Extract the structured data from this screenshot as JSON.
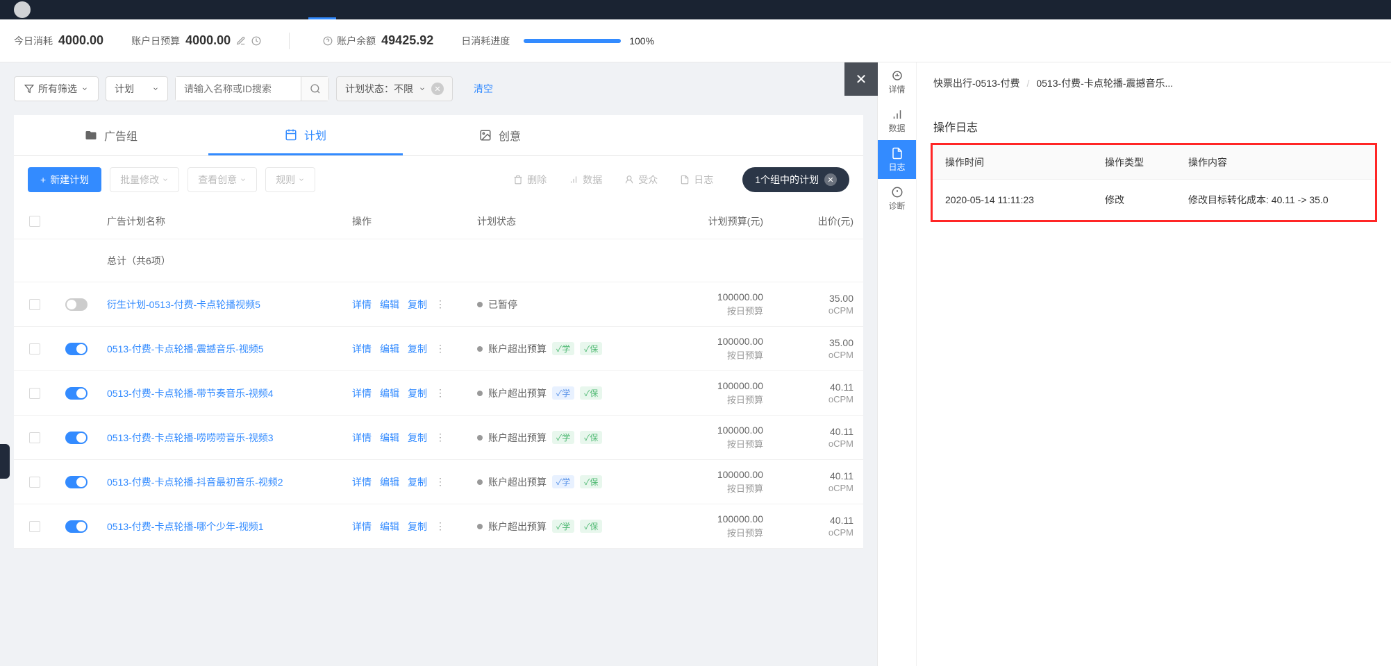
{
  "stats": {
    "today_spend_label": "今日消耗",
    "today_spend_value": "4000.00",
    "daily_budget_label": "账户日预算",
    "daily_budget_value": "4000.00",
    "balance_label": "账户余额",
    "balance_value": "49425.92",
    "progress_label": "日消耗进度",
    "progress_value": "100%",
    "progress_pct": 100
  },
  "filters": {
    "all_label": "所有筛选",
    "level_label": "计划",
    "search_placeholder": "请输入名称或ID搜索",
    "status_label": "计划状态：不限",
    "clear_label": "清空"
  },
  "tabs": {
    "adgroup": "广告组",
    "plan": "计划",
    "creative": "创意"
  },
  "toolbar": {
    "new_plan": "新建计划",
    "batch_modify": "批量修改",
    "view_creative": "查看创意",
    "rules": "规则",
    "delete": "删除",
    "data": "数据",
    "audience": "受众",
    "log": "日志",
    "group_badge": "1个组中的计划"
  },
  "table": {
    "headers": {
      "name": "广告计划名称",
      "action": "操作",
      "status": "计划状态",
      "budget": "计划预算(元)",
      "bid": "出价(元)"
    },
    "summary": "总计（共6项）",
    "action_labels": {
      "detail": "详情",
      "edit": "编辑",
      "copy": "复制"
    },
    "budget_sub": "按日预算",
    "bid_sub": "oCPM",
    "rows": [
      {
        "on": false,
        "name": "衍生计划-0513-付费-卡点轮播视频5",
        "status": "已暂停",
        "tag1": "",
        "tag2": "",
        "budget": "100000.00",
        "bid": "35.00"
      },
      {
        "on": true,
        "name": "0513-付费-卡点轮播-震撼音乐-视频5",
        "status": "账户超出预算",
        "tag1": "学",
        "tag1c": "green",
        "tag2": "保",
        "budget": "100000.00",
        "bid": "35.00"
      },
      {
        "on": true,
        "name": "0513-付费-卡点轮播-带节奏音乐-视频4",
        "status": "账户超出预算",
        "tag1": "学",
        "tag1c": "blue",
        "tag2": "保",
        "budget": "100000.00",
        "bid": "40.11"
      },
      {
        "on": true,
        "name": "0513-付费-卡点轮播-唠唠唠音乐-视频3",
        "status": "账户超出预算",
        "tag1": "学",
        "tag1c": "green",
        "tag2": "保",
        "budget": "100000.00",
        "bid": "40.11"
      },
      {
        "on": true,
        "name": "0513-付费-卡点轮播-抖音最初音乐-视频2",
        "status": "账户超出预算",
        "tag1": "学",
        "tag1c": "blue",
        "tag2": "保",
        "budget": "100000.00",
        "bid": "40.11"
      },
      {
        "on": true,
        "name": "0513-付费-卡点轮播-哪个少年-视频1",
        "status": "账户超出预算",
        "tag1": "学",
        "tag1c": "green",
        "tag2": "保",
        "budget": "100000.00",
        "bid": "40.11"
      }
    ]
  },
  "side_nav": {
    "detail": "详情",
    "data": "数据",
    "log": "日志",
    "diagnose": "诊断"
  },
  "breadcrumb": {
    "root": "快票出行-0513-付费",
    "current": "0513-付费-卡点轮播-震撼音乐..."
  },
  "log_panel": {
    "title": "操作日志",
    "headers": {
      "time": "操作时间",
      "type": "操作类型",
      "content": "操作内容"
    },
    "rows": [
      {
        "time": "2020-05-14 11:11:23",
        "type": "修改",
        "content": "修改目标转化成本: 40.11 -> 35.0"
      }
    ]
  }
}
